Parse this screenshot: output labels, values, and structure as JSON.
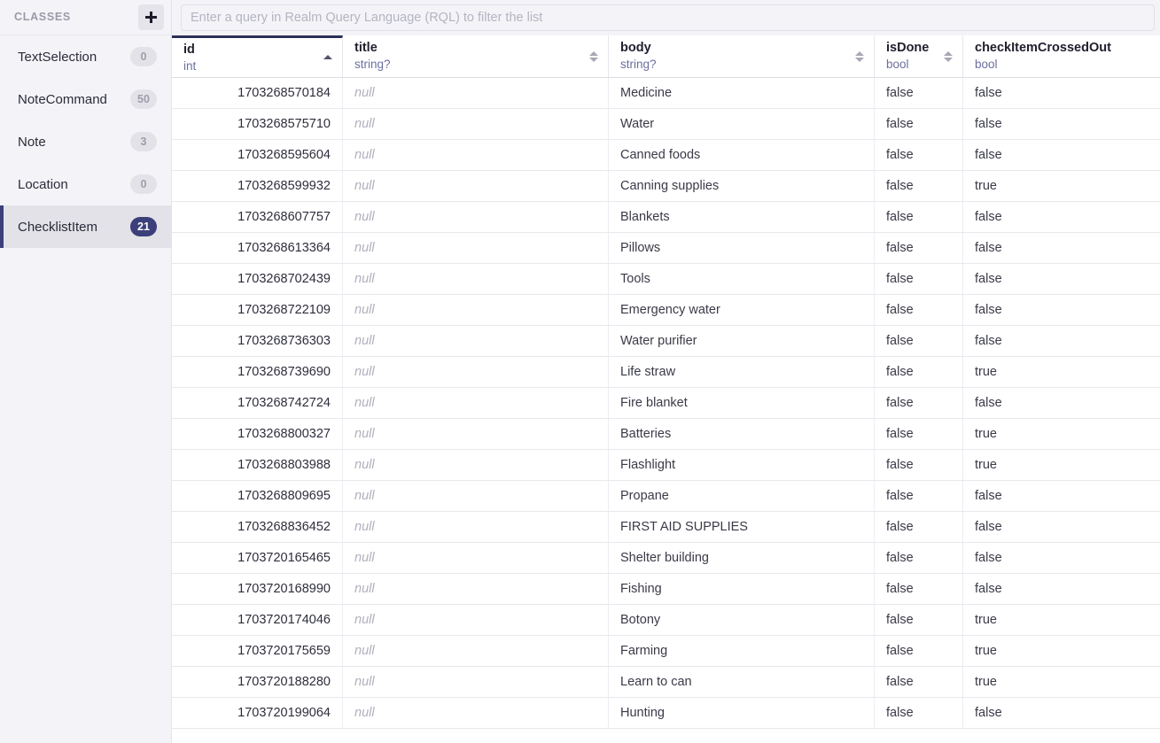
{
  "sidebar": {
    "title": "CLASSES",
    "add_button_label": "+",
    "add_button_icon": "plus-icon",
    "items": [
      {
        "label": "TextSelection",
        "count": "0",
        "selected": false
      },
      {
        "label": "NoteCommand",
        "count": "50",
        "selected": false
      },
      {
        "label": "Note",
        "count": "3",
        "selected": false
      },
      {
        "label": "Location",
        "count": "0",
        "selected": false
      },
      {
        "label": "ChecklistItem",
        "count": "21",
        "selected": true
      }
    ]
  },
  "query": {
    "placeholder": "Enter a query in Realm Query Language (RQL) to filter the list",
    "value": ""
  },
  "table": {
    "columns": [
      {
        "name": "id",
        "type": "int",
        "sort": "asc",
        "align": "right"
      },
      {
        "name": "title",
        "type": "string?",
        "sort": "none",
        "align": "left"
      },
      {
        "name": "body",
        "type": "string?",
        "sort": "none",
        "align": "left"
      },
      {
        "name": "isDone",
        "type": "bool",
        "sort": "none",
        "align": "left"
      },
      {
        "name": "checkItemCrossedOut",
        "type": "bool",
        "sort": "none",
        "align": "left"
      }
    ],
    "null_label": "null",
    "rows": [
      {
        "id": "1703268570184",
        "title": "null",
        "body": "Medicine",
        "isDone": "false",
        "checkItemCrossedOut": "false"
      },
      {
        "id": "1703268575710",
        "title": "null",
        "body": "Water",
        "isDone": "false",
        "checkItemCrossedOut": "false"
      },
      {
        "id": "1703268595604",
        "title": "null",
        "body": "Canned foods",
        "isDone": "false",
        "checkItemCrossedOut": "false"
      },
      {
        "id": "1703268599932",
        "title": "null",
        "body": "Canning supplies",
        "isDone": "false",
        "checkItemCrossedOut": "true"
      },
      {
        "id": "1703268607757",
        "title": "null",
        "body": "Blankets",
        "isDone": "false",
        "checkItemCrossedOut": "false"
      },
      {
        "id": "1703268613364",
        "title": "null",
        "body": "Pillows",
        "isDone": "false",
        "checkItemCrossedOut": "false"
      },
      {
        "id": "1703268702439",
        "title": "null",
        "body": "Tools",
        "isDone": "false",
        "checkItemCrossedOut": "false"
      },
      {
        "id": "1703268722109",
        "title": "null",
        "body": "Emergency water",
        "isDone": "false",
        "checkItemCrossedOut": "false"
      },
      {
        "id": "1703268736303",
        "title": "null",
        "body": "Water purifier",
        "isDone": "false",
        "checkItemCrossedOut": "false"
      },
      {
        "id": "1703268739690",
        "title": "null",
        "body": "Life straw",
        "isDone": "false",
        "checkItemCrossedOut": "true"
      },
      {
        "id": "1703268742724",
        "title": "null",
        "body": "Fire blanket",
        "isDone": "false",
        "checkItemCrossedOut": "false"
      },
      {
        "id": "1703268800327",
        "title": "null",
        "body": "Batteries",
        "isDone": "false",
        "checkItemCrossedOut": "true"
      },
      {
        "id": "1703268803988",
        "title": "null",
        "body": "Flashlight",
        "isDone": "false",
        "checkItemCrossedOut": "true"
      },
      {
        "id": "1703268809695",
        "title": "null",
        "body": "Propane",
        "isDone": "false",
        "checkItemCrossedOut": "false"
      },
      {
        "id": "1703268836452",
        "title": "null",
        "body": "FIRST AID SUPPLIES",
        "isDone": "false",
        "checkItemCrossedOut": "false"
      },
      {
        "id": "1703720165465",
        "title": "null",
        "body": "Shelter building",
        "isDone": "false",
        "checkItemCrossedOut": "false"
      },
      {
        "id": "1703720168990",
        "title": "null",
        "body": "Fishing",
        "isDone": "false",
        "checkItemCrossedOut": "false"
      },
      {
        "id": "1703720174046",
        "title": "null",
        "body": "Botony",
        "isDone": "false",
        "checkItemCrossedOut": "true"
      },
      {
        "id": "1703720175659",
        "title": "null",
        "body": "Farming",
        "isDone": "false",
        "checkItemCrossedOut": "true"
      },
      {
        "id": "1703720188280",
        "title": "null",
        "body": "Learn to can",
        "isDone": "false",
        "checkItemCrossedOut": "true"
      },
      {
        "id": "1703720199064",
        "title": "null",
        "body": "Hunting",
        "isDone": "false",
        "checkItemCrossedOut": "false"
      }
    ]
  },
  "colors": {
    "sidebar_bg": "#f4f4f8",
    "selected_bg": "#e2e2e8",
    "accent": "#3b3f7a",
    "sorted_border": "#2c3157",
    "type_text": "#6b6f9e"
  }
}
